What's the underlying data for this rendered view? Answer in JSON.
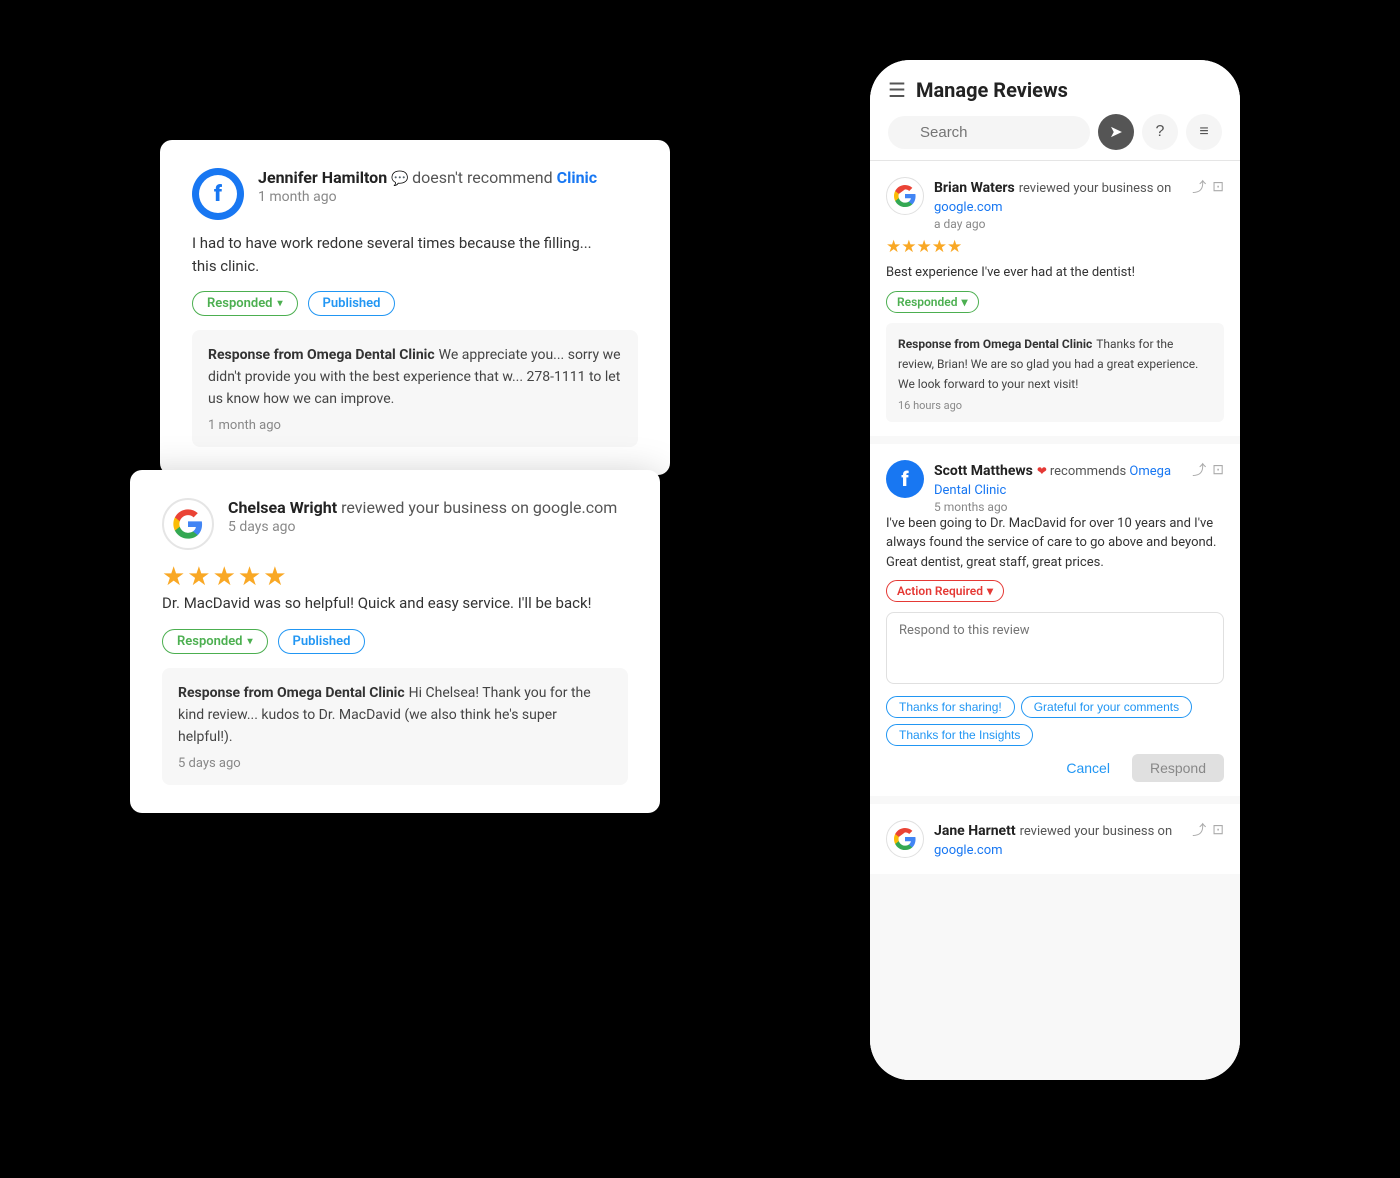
{
  "phone": {
    "title": "Manage Reviews",
    "search_placeholder": "Search",
    "reviews": [
      {
        "id": "brian-waters",
        "platform": "google",
        "reviewer": "Brian Waters",
        "action": "reviewed your business on",
        "business_link": "google.com",
        "date": "a day ago",
        "stars": 5,
        "text": "Best experience I've ever had at the dentist!",
        "status": "responded",
        "status_label": "Responded",
        "response": {
          "from": "Response from Omega Dental Clinic",
          "text": "Thanks for the review, Brian! We are so glad you had a great experience. We look forward to your next visit!",
          "date": "16 hours ago"
        }
      },
      {
        "id": "scott-matthews",
        "platform": "facebook",
        "reviewer": "Scott Matthews",
        "action": "recommends",
        "business_link": "Omega Dental Clinic",
        "date": "5 months ago",
        "stars": 0,
        "text": "I've been going to Dr. MacDavid for over 10 years and I've always found the service of care to go above and beyond. Great dentist, great staff, great prices.",
        "status": "action-required",
        "status_label": "Action Required",
        "respond_placeholder": "Respond to this review",
        "suggestions": [
          "Thanks for sharing!",
          "Grateful for your comments",
          "Thanks for the Insights"
        ],
        "cancel_label": "Cancel",
        "respond_label": "Respond"
      },
      {
        "id": "jane-harnett",
        "platform": "google",
        "reviewer": "Jane Harnett",
        "action": "reviewed your business on",
        "business_link": "google.com",
        "date": "",
        "stars": 0,
        "text": "",
        "status": "none"
      }
    ]
  },
  "card_fb": {
    "reviewer": "Jennifer Hamilton",
    "doesnt_recommend": "doesn't recommend",
    "business_link": "Clinic",
    "date": "1 month ago",
    "text": "I had to have work redone several times because the filling...\nthis clinic.",
    "responded_label": "Responded",
    "published_label": "Published",
    "response_from": "Response from Omega Dental Clinic",
    "response_text": "We appreciate you... sorry we didn't provide you with the best experience that w... 278-1111 to let us know how we can improve.",
    "response_date": "1 month ago"
  },
  "card_google": {
    "reviewer": "Chelsea Wright",
    "action": "reviewed your business on google.com",
    "date": "5 days ago",
    "stars": 5,
    "text": "Dr. MacDavid was so helpful! Quick and easy service. I'll be back!",
    "responded_label": "Responded",
    "published_label": "Published",
    "response_from": "Response from Omega Dental Clinic",
    "response_text": "Hi Chelsea! Thank you for the kind review... kudos to Dr. MacDavid (we also think he's super helpful!).",
    "response_date": "5 days ago"
  }
}
